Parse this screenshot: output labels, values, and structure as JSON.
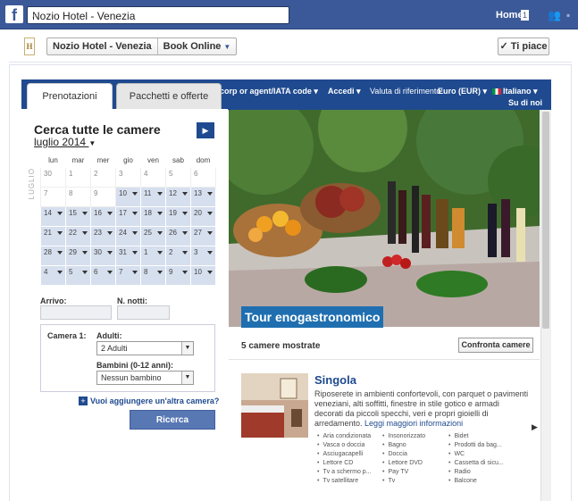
{
  "fb": {
    "search_value": "Nozio Hotel - Venezia",
    "home_label": "Home",
    "home_badge": "1"
  },
  "page_header": {
    "page_name": "Nozio Hotel - Venezia",
    "app_name": "Book Online",
    "like_label": "✓ Ti piace",
    "logo_text": "H"
  },
  "bluebar": {
    "corp": "corp or agent/IATA code ▾",
    "accedi": "Accedi ▾",
    "valuta_label": "Valuta di riferimento:",
    "valuta_value": "Euro (EUR) ▾",
    "lingua": "Italiano ▾",
    "su_di_noi": "Su di noi"
  },
  "tabs": [
    "Prenotazioni",
    "Pacchetti e offerte"
  ],
  "search": {
    "title": "Cerca tutte le camere",
    "month": "luglio 2014",
    "vertical_month": "LUGLIO",
    "weekdays": [
      "lun",
      "mar",
      "mer",
      "gio",
      "ven",
      "sab",
      "dom"
    ],
    "weeks": [
      [
        {
          "d": "30",
          "dim": true
        },
        {
          "d": "1",
          "dim": true
        },
        {
          "d": "2",
          "dim": true
        },
        {
          "d": "3",
          "dim": true
        },
        {
          "d": "4",
          "dim": true
        },
        {
          "d": "5",
          "dim": true
        },
        {
          "d": "6",
          "dim": true
        }
      ],
      [
        {
          "d": "7",
          "dim": true
        },
        {
          "d": "8",
          "dim": true
        },
        {
          "d": "9",
          "dim": true
        },
        {
          "d": "10"
        },
        {
          "d": "11"
        },
        {
          "d": "12"
        },
        {
          "d": "13"
        }
      ],
      [
        {
          "d": "14"
        },
        {
          "d": "15"
        },
        {
          "d": "16"
        },
        {
          "d": "17"
        },
        {
          "d": "18"
        },
        {
          "d": "19"
        },
        {
          "d": "20"
        }
      ],
      [
        {
          "d": "21"
        },
        {
          "d": "22"
        },
        {
          "d": "23"
        },
        {
          "d": "24"
        },
        {
          "d": "25"
        },
        {
          "d": "26"
        },
        {
          "d": "27"
        }
      ],
      [
        {
          "d": "28"
        },
        {
          "d": "29"
        },
        {
          "d": "30"
        },
        {
          "d": "31"
        },
        {
          "d": "1"
        },
        {
          "d": "2"
        },
        {
          "d": "3"
        }
      ],
      [
        {
          "d": "4"
        },
        {
          "d": "5"
        },
        {
          "d": "6"
        },
        {
          "d": "7"
        },
        {
          "d": "8"
        },
        {
          "d": "9"
        },
        {
          "d": "10"
        }
      ]
    ],
    "arrivo_label": "Arrivo:",
    "notti_label": "N. notti:",
    "camera_label": "Camera 1:",
    "adulti_label": "Adulti:",
    "adulti_value": "2 Adulti",
    "bambini_label": "Bambini (0-12 anni):",
    "bambini_value": "Nessun bambino",
    "add_room": "Vuoi aggiungere un'altra camera?",
    "search_button": "Ricerca"
  },
  "hero": {
    "caption": "Tour enogastronomico"
  },
  "results": {
    "count_text": "5 camere mostrate",
    "compare_button": "Confronta camere",
    "room": {
      "title": "Singola",
      "description": "Riposerete in ambienti confortevoli, con parquet o pavimenti veneziani, alti soffitti, finestre in stile gotico e armadi decorati da piccoli specchi, veri e propri gioielli di arredamento.",
      "more_link": "Leggi maggiori informazioni",
      "amenities_col1": [
        "Aria condizionata",
        "Vasca o doccia",
        "Asciugacapelli",
        "Lettore CD",
        "Tv a schermo p...",
        "Tv satellitare"
      ],
      "amenities_col2": [
        "Insonorizzato",
        "Bagno",
        "Doccia",
        "Lettore DVD",
        "Pay TV",
        "Tv"
      ],
      "amenities_col3": [
        "Bidet",
        "Prodotti da bag...",
        "WC",
        "Cassetta di sicu...",
        "Radio",
        "Balcone"
      ]
    }
  }
}
